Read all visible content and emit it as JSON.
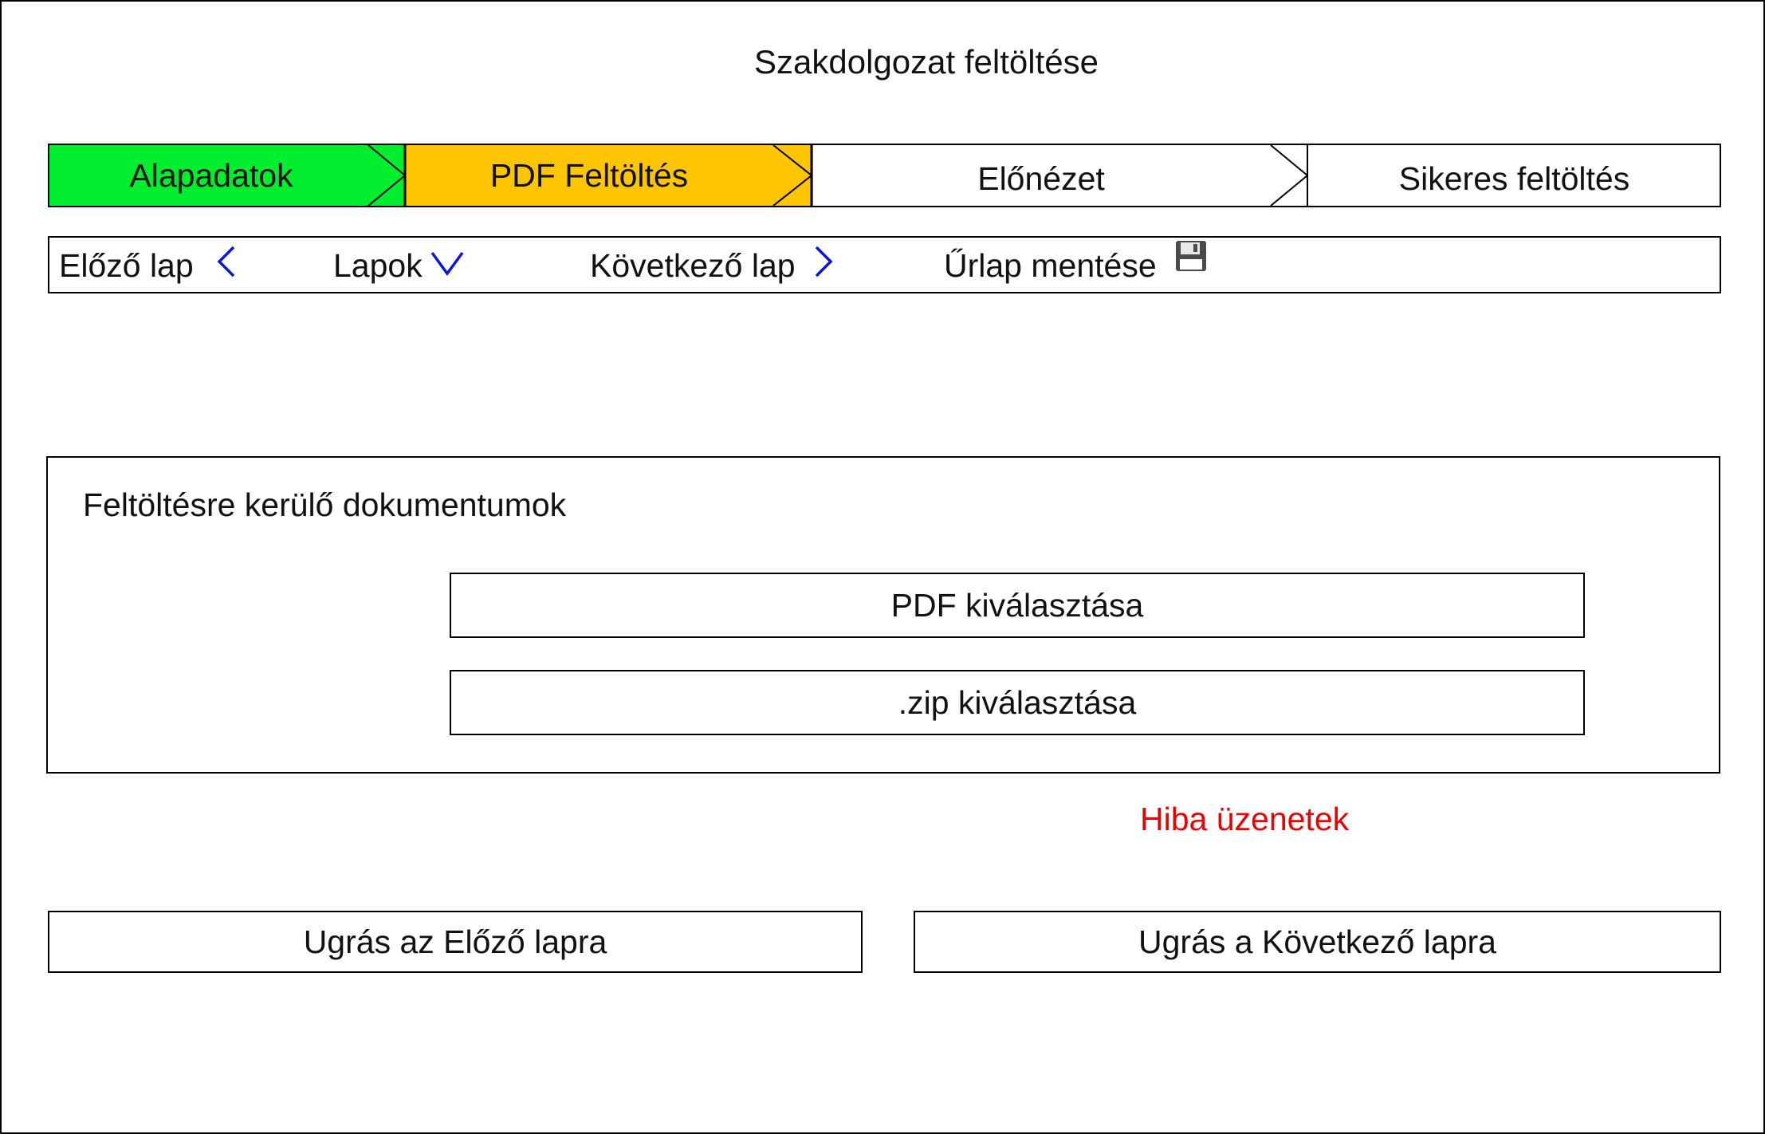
{
  "page": {
    "title": "Szakdolgozat feltöltése"
  },
  "stepper": {
    "steps": [
      {
        "label": "Alapadatok",
        "state": "completed",
        "color": "#00ee2e"
      },
      {
        "label": "PDF Feltöltés",
        "state": "current",
        "color": "#ffc500"
      },
      {
        "label": "Előnézet",
        "state": "pending",
        "color": "#ffffff"
      },
      {
        "label": "Sikeres feltöltés",
        "state": "pending",
        "color": "#ffffff"
      }
    ]
  },
  "toolbar": {
    "prev_label": "Előző lap",
    "pages_label": "Lapok",
    "next_label": "Következő lap",
    "save_label": "Űrlap mentése",
    "icon_color": "#0a14e6",
    "icons": {
      "prev": "chevron-left-icon",
      "pages": "chevron-down-icon",
      "next": "chevron-right-icon",
      "save": "floppy-disk-icon"
    }
  },
  "documents": {
    "title": "Feltöltésre kerülő dokumentumok",
    "pdf_button": "PDF kiválasztása",
    "zip_button": ".zip kiválasztása"
  },
  "errors": {
    "text": "Hiba üzenetek",
    "color": "#f00000"
  },
  "footer": {
    "prev_button": "Ugrás az Előző lapra",
    "next_button": "Ugrás a Következő lapra"
  }
}
